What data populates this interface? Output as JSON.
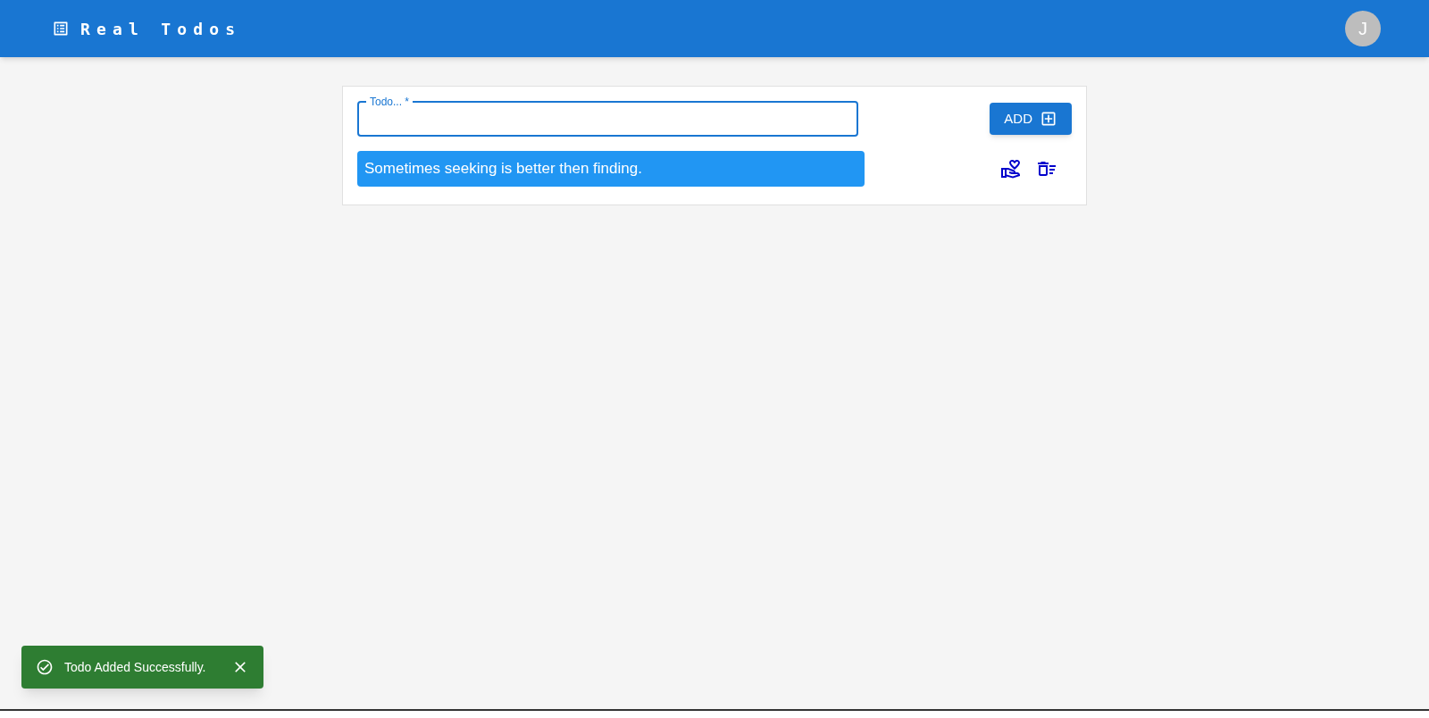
{
  "app_bar": {
    "title": "Real Todos",
    "avatar": "J"
  },
  "todo_form": {
    "label": "Todo... *",
    "button": "ADD"
  },
  "todos": [
    {
      "text": "Sometimes seeking is better then finding."
    }
  ],
  "snackbar": {
    "message": "Todo Added Successfully."
  }
}
